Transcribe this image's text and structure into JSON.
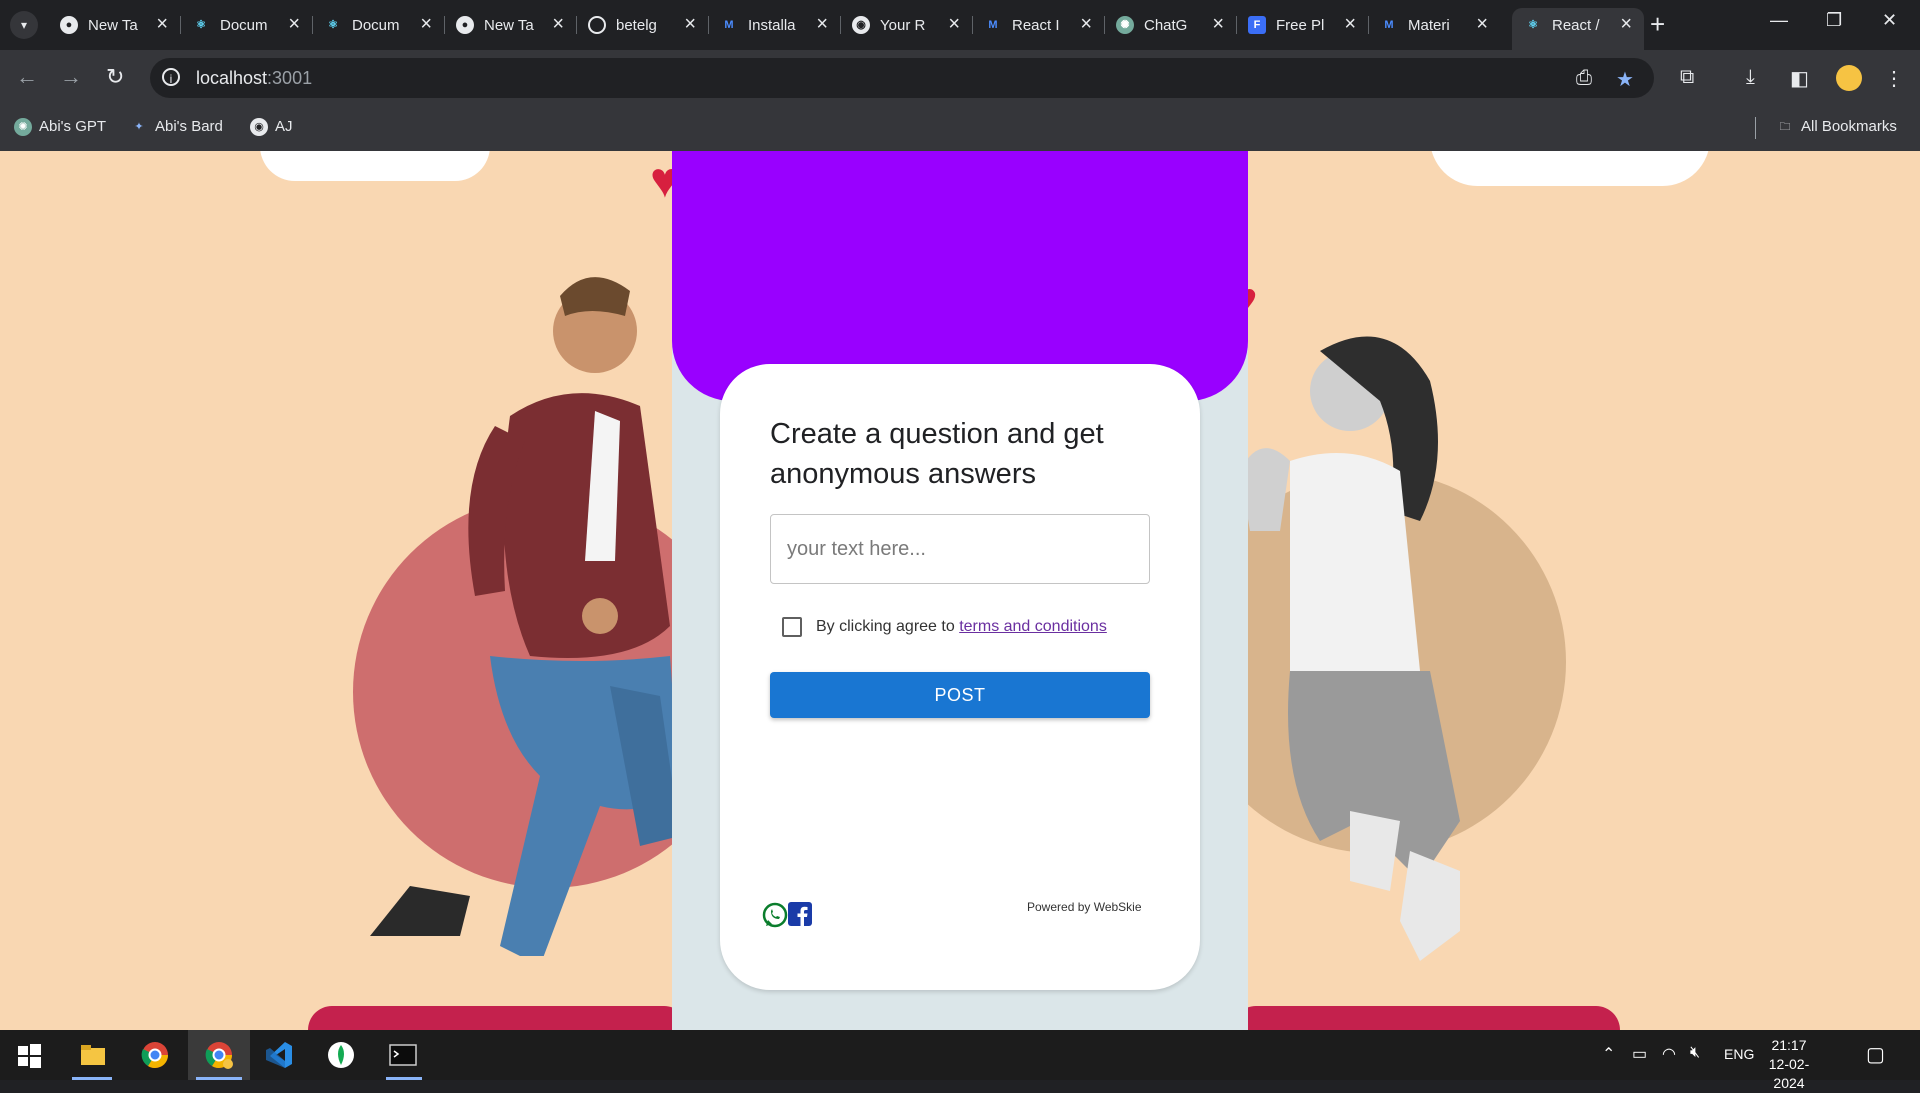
{
  "browser": {
    "tabs": [
      {
        "title": "New Ta",
        "favicon": "chrome-icon"
      },
      {
        "title": "Docum",
        "favicon": "react-icon"
      },
      {
        "title": "Docum",
        "favicon": "react-icon"
      },
      {
        "title": "New Ta",
        "favicon": "chrome-icon"
      },
      {
        "title": "betelg",
        "favicon": "generic-globe-icon"
      },
      {
        "title": "Installa",
        "favicon": "mui-icon"
      },
      {
        "title": "Your R",
        "favicon": "github-icon"
      },
      {
        "title": "React I",
        "favicon": "mui-icon"
      },
      {
        "title": "ChatG",
        "favicon": "chatgpt-icon"
      },
      {
        "title": "Free Pl",
        "favicon": "form-icon"
      },
      {
        "title": "Materi",
        "favicon": "mui-icon"
      },
      {
        "title": "React /",
        "favicon": "react-icon",
        "active": true
      }
    ],
    "url_host": "localhost",
    "url_port": ":3001",
    "bookmarks": [
      "Abi's GPT",
      "Abi's Bard",
      "AJ"
    ],
    "all_bookmarks": "All Bookmarks"
  },
  "page": {
    "title": "Create a question and get anonymous answers",
    "input_placeholder": "your text here...",
    "terms_prefix": "By clicking agree to ",
    "terms_link": "terms and conditions",
    "post_button": "POST",
    "powered_by": "Powered by WebSkie",
    "colors": {
      "header": "#9900ff",
      "button": "#1976d2",
      "background": "#f9d7b2"
    }
  },
  "taskbar": {
    "language": "ENG",
    "time": "21:17",
    "date": "12-02-2024"
  }
}
